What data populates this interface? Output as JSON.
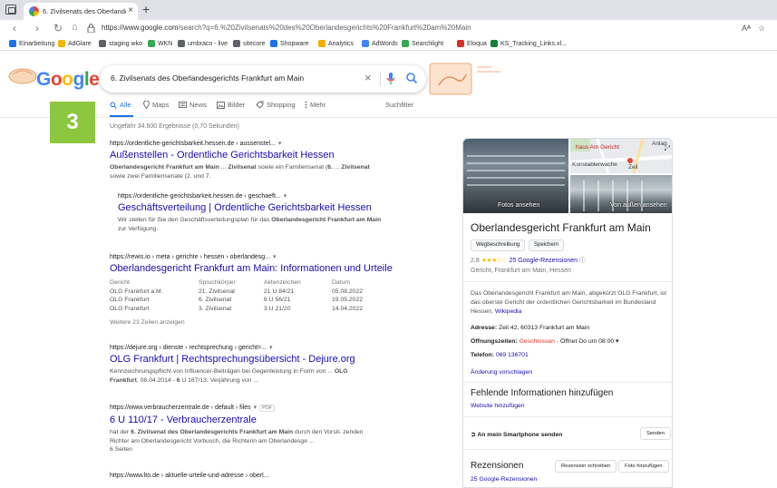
{
  "browser": {
    "tab_title": "6. Zivilsenats des Oberlandesger",
    "tab_close": "×",
    "new_tab": "+",
    "url_host": "https://www.google.com",
    "url_path": "/search?q=6.%20Zivilsenats%20des%20Oberlandesgerichts%20Frankfurt%20am%20Main",
    "read_aloud": "Aᴬ",
    "bookmarks": [
      {
        "label": "Einarbeitung",
        "color": "#1a73e8"
      },
      {
        "label": "AdGlare",
        "color": "#f4b400"
      },
      {
        "label": "staging wko",
        "color": "#5f6368"
      },
      {
        "label": "WKN",
        "color": "#34a853"
      },
      {
        "label": "umbraco - live",
        "color": "#5f6368"
      },
      {
        "label": "sitecore",
        "color": "#5f6368"
      },
      {
        "label": "Shopware",
        "color": "#1a73e8"
      },
      {
        "label": "Analytics",
        "color": "#f9ab00"
      },
      {
        "label": "AdWords",
        "color": "#4285f4"
      },
      {
        "label": "Searchlight",
        "color": "#34a853"
      },
      {
        "label": "Eloqua",
        "color": "#d93025"
      },
      {
        "label": "KS_Tracking_Links.xl...",
        "color": "#188038"
      }
    ]
  },
  "search": {
    "logo": [
      "G",
      "o",
      "o",
      "g",
      "l",
      "e"
    ],
    "logo_colors": [
      "#4285f4",
      "#ea4335",
      "#fbbc05",
      "#4285f4",
      "#34a853",
      "#ea4335"
    ],
    "query": "6. Zivilsenats des Oberlandesgerichts Frankfurt am Main",
    "clear": "×",
    "tabs": [
      {
        "label": "Alle",
        "active": true
      },
      {
        "label": "Maps",
        "active": false
      },
      {
        "label": "News",
        "active": false
      },
      {
        "label": "Bilder",
        "active": false
      },
      {
        "label": "Shopping",
        "active": false
      },
      {
        "label": "Mehr",
        "active": false
      }
    ],
    "filter_label": "Suchfilter",
    "stats": "Ungefähr 34.600 Ergebnisse (0,70 Sekunden)"
  },
  "step_badge": "3",
  "results": [
    {
      "url": "https://ordentliche-gerichtsbarkeit.hessen.de › aussenstel...",
      "title": "Außenstellen - Ordentliche Gerichtsbarkeit Hessen",
      "snippet": [
        [
          "Oberlandesgericht Frankfurt am Main",
          " ... ",
          "Zivilsenat",
          " sowie ein Familiensenat (",
          "6.",
          " ... ",
          "Zivilsenat"
        ],
        [
          "sowie zwei Familiensenate (2. und 7."
        ]
      ]
    },
    {
      "url": "https://ordentliche-gerichtsbarkeit.hessen.de › geschaeft...",
      "title": "Geschäftsverteilung | Ordentliche Gerichtsbarkeit Hessen",
      "snippet": [
        [
          "Wir stellen für Sie den Geschäftsverteilungsplan für das ",
          "Oberlandesgericht Frankfurt am Main"
        ],
        [
          "zur Verfügung."
        ]
      ]
    },
    {
      "url": "https://rewis.io › meta › gerichte › hessen › oberlandesg...",
      "title": "Oberlandesgericht Frankfurt am Main: Informationen und Urteile",
      "table": {
        "headers": [
          "Gericht",
          "Spruchkörper",
          "Aktenzeichen",
          "Datum"
        ],
        "rows": [
          [
            "OLG Frankfurt a.M.",
            "21. Zivilsenat",
            "21 U 84/21",
            "05.08.2022"
          ],
          [
            "OLG Frankfurt",
            "6. Zivilsenat",
            "6 U 56/21",
            "19.05.2022"
          ],
          [
            "OLG Frankfurt",
            "3. Zivilsenat",
            "3 U 21/20",
            "14.04.2022"
          ]
        ],
        "more": "Weitere 23 Zeilen anzeigen"
      }
    },
    {
      "url": "https://dejure.org › dienste › rechtsprechung › gericht=...",
      "title": "OLG Frankfurt | Rechtsprechungsübersicht - Dejure.org",
      "snippet": [
        [
          "Kennzeichnungspflicht von Influencer-Beiträgen bei Gegenleistung in Form von ... ",
          "OLG"
        ],
        [
          "Frankfurt",
          ", 08.04.2014 - ",
          "6",
          " U 167/13: Verjährung von ..."
        ]
      ]
    },
    {
      "url": "https://www.verbraucherzentrale.de › default › files",
      "pdf": "PDF",
      "title": "6 U 110/17 - Verbraucherzentrale",
      "snippet": [
        [
          "hat der ",
          "6. Zivilsenat des Oberlandesgerichts Frankfurt am Main",
          " durch den Vorsit- zenden"
        ],
        [
          "Richter am Oberlandesgericht Vorbusch, die Richterin am Oberlandesge ..."
        ],
        [
          "6 Seiten"
        ]
      ]
    },
    {
      "url": "https://www.lto.de › aktuelle-urteile-und-adresse › oberl..."
    }
  ],
  "knowledge_panel": {
    "map_label_1": "haus Am Gericht",
    "map_label_2": "Konstablerwache",
    "map_label_3": "Zeil",
    "map_label_4": "Anlag",
    "photos_caption": "Fotos ansehen",
    "outside_caption": "Von außen ansehen",
    "title": "Oberlandesgericht Frankfurt am Main",
    "btn_directions": "Wegbeschreibung",
    "btn_save": "Speichern",
    "rating_value": "2,8",
    "stars": "★★★☆☆",
    "reviews_link": "25 Google-Rezensionen",
    "category": "Gericht, Frankfurt am Main, Hessen",
    "description": "Das Oberlandesgericht Frankfurt am Main, abgekürzt OLG Frankfurt, ist das oberste Gericht der ordentlichen Gerichtsbarkeit im Bundesland Hessen.",
    "wiki_link": "Wikipedia",
    "address_label": "Adresse:",
    "address_value": " Zeil 42, 60313 Frankfurt am Main",
    "hours_label": "Öffnungszeiten:",
    "hours_status": " Geschlossen",
    "hours_next": " · Öffnet Do um 08:00 ▾",
    "phone_label": "Telefon:",
    "phone_value": " 069 136701",
    "suggest_edit": "Änderung vorschlagen",
    "missing_heading": "Fehlende Informationen hinzufügen",
    "add_website": "Website hinzufügen",
    "send_phone_label": "An mein Smartphone senden",
    "send_button": "Senden",
    "reviews_heading": "Rezensionen",
    "write_review": "Rezension schreiben",
    "add_photo": "Foto hinzufügen",
    "reviews_count_link": "25 Google-Rezensionen"
  }
}
